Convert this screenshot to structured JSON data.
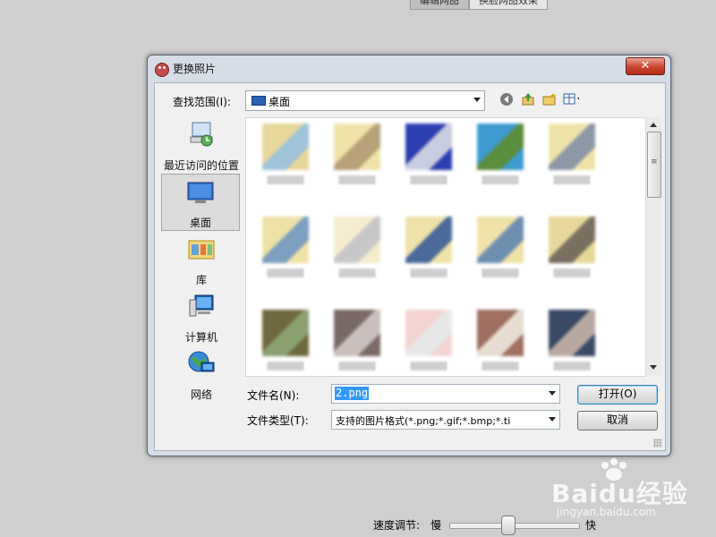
{
  "top_tabs": [
    "编辑网图",
    "换脸网图效果"
  ],
  "dialog": {
    "title": "更换照片",
    "close_label": "✕",
    "look_in_label": "查找范围(I):",
    "look_in_value": "桌面",
    "places": [
      {
        "label": "最近访问的位置",
        "icon": "recent-places-icon"
      },
      {
        "label": "桌面",
        "icon": "desktop-icon",
        "selected": true
      },
      {
        "label": "库",
        "icon": "libraries-icon"
      },
      {
        "label": "计算机",
        "icon": "computer-icon"
      },
      {
        "label": "网络",
        "icon": "network-icon"
      }
    ],
    "filename_label": "文件名(N):",
    "filename_value": "2.png",
    "filetype_label": "文件类型(T):",
    "filetype_value": "支持的图片格式(*.png;*.gif;*.bmp;*.ti",
    "open_button": "打开(O)",
    "cancel_button": "取消",
    "file_thumbs": [
      {
        "c1": "#e8d79a",
        "c2": "#9fc3d8"
      },
      {
        "c1": "#efe2a8",
        "c2": "#b7a27a"
      },
      {
        "c1": "#2c3fb0",
        "c2": "#c9cde0"
      },
      {
        "c1": "#3d9bd0",
        "c2": "#5a8d3c"
      },
      {
        "c1": "#efe2a8",
        "c2": "#8c97a6"
      },
      {
        "c1": "#efe2a8",
        "c2": "#7ea0c0"
      },
      {
        "c1": "#f4eccc",
        "c2": "#c8c8c8"
      },
      {
        "c1": "#efe2a8",
        "c2": "#4a6a9a"
      },
      {
        "c1": "#efe2a8",
        "c2": "#6f8fb0"
      },
      {
        "c1": "#e8d79a",
        "c2": "#7a7060"
      },
      {
        "c1": "#6f6a3e",
        "c2": "#8aa070"
      },
      {
        "c1": "#7a6a66",
        "c2": "#c9bfbd"
      },
      {
        "c1": "#f3d4d2",
        "c2": "#e8e8e8"
      },
      {
        "c1": "#a07060",
        "c2": "#e6ddd0"
      },
      {
        "c1": "#3a4a66",
        "c2": "#b8a8a0"
      }
    ]
  },
  "speed": {
    "label": "速度调节:",
    "slow": "慢",
    "fast": "快",
    "value": 0.45
  },
  "watermark": {
    "main": "Baidu经验",
    "sub": "jingyan.baidu.com"
  }
}
